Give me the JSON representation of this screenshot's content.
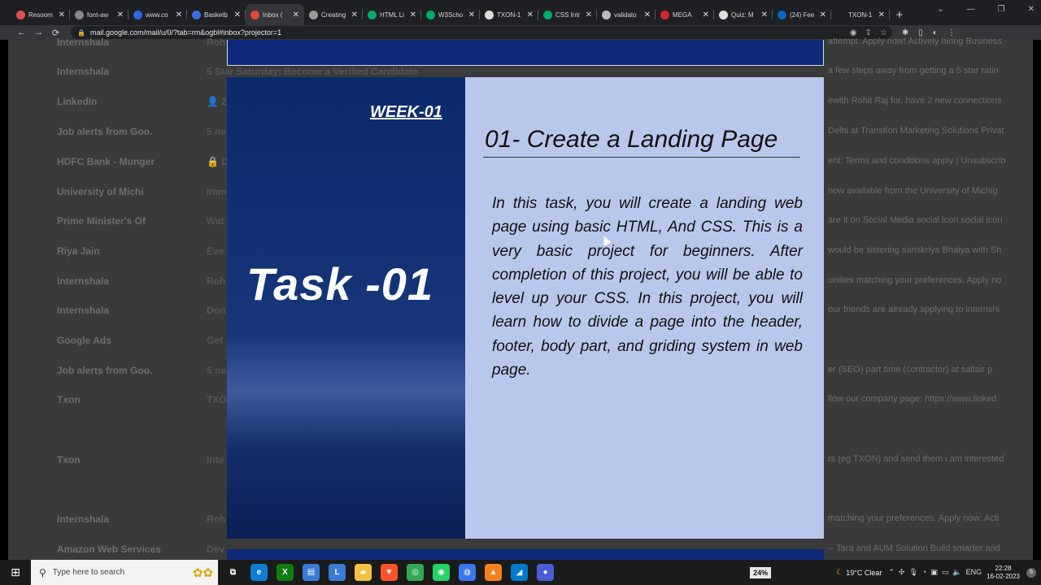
{
  "browser": {
    "tabs": [
      {
        "label": "Resoom",
        "icon": "red-circle-icon",
        "color": "#e05050"
      },
      {
        "label": "font-aw",
        "icon": "code-icon",
        "color": "#888888"
      },
      {
        "label": "www.co",
        "icon": "c-icon",
        "color": "#2a6ae0"
      },
      {
        "label": "Basketb",
        "icon": "flag-icon",
        "color": "#3b6fe0"
      },
      {
        "label": "Inbox (",
        "icon": "gmail-icon",
        "color": "#e04a3a",
        "active": true
      },
      {
        "label": "Creating",
        "icon": "doc-icon",
        "color": "#999999"
      },
      {
        "label": "HTML Li",
        "icon": "w-icon",
        "color": "#04aa6d"
      },
      {
        "label": "W3Scho",
        "icon": "w-icon",
        "color": "#04aa6d"
      },
      {
        "label": "TXON-1",
        "icon": "github-icon",
        "color": "#dddddd"
      },
      {
        "label": "CSS Intr",
        "icon": "w-icon",
        "color": "#04aa6d"
      },
      {
        "label": "validato",
        "icon": "validator-icon",
        "color": "#bbbbbb"
      },
      {
        "label": "MEGA",
        "icon": "mega-icon",
        "color": "#d9272e"
      },
      {
        "label": "Quiz: M",
        "icon": "g-icon",
        "color": "#dddddd"
      },
      {
        "label": "(24) Fee",
        "icon": "linkedin-icon",
        "color": "#0a66c2"
      },
      {
        "label": "TXON-1",
        "icon": "blank-icon",
        "color": "#1f2023"
      }
    ],
    "new_tab": "+",
    "url": "mail.google.com/mail/u/0/?tab=rm&ogbl#inbox?projector=1",
    "nav": {
      "back": "←",
      "forward": "→",
      "reload": "⟳"
    }
  },
  "inbox": {
    "rows": [
      {
        "sender": "Internshala",
        "subject": "Roh",
        "snippet": "attempt. Apply now! Actively hiring Business"
      },
      {
        "sender": "Internshala",
        "subject": "5 Star Saturday: Become a Verified Candidate",
        "snippet": "a few steps away from getting a 5 star ratin"
      },
      {
        "sender": "LinkedIn",
        "subject": "👤 2",
        "snippet": "ewith Rohit Raj for, have 2 new connections"
      },
      {
        "sender": "Job alerts from Goo.",
        "subject": "5 ne",
        "snippet": "Delhi at Transtion Marketing Solutions Privat"
      },
      {
        "sender": "HDFC Bank - Munger",
        "subject": "🔒 D",
        "snippet": "ent: Terms and conditions apply | Unsubscrib"
      },
      {
        "sender": "University of Michi",
        "subject": "Imm",
        "snippet": "now available from the University of Michig"
      },
      {
        "sender": "Prime Minister's Of",
        "subject": "Wat",
        "snippet": "are it on Social Media social icon social icon"
      },
      {
        "sender": "Riya Jain",
        "subject": "Eve",
        "snippet": "would be sistering sanskriya Bhaiya with Sh"
      },
      {
        "sender": "Internshala",
        "subject": "Roh",
        "snippet": "unities matching your preferences. Apply no"
      },
      {
        "sender": "Internshala",
        "subject": "Don",
        "snippet": "our friends are already applying to internshi"
      },
      {
        "sender": "Google Ads",
        "subject": "Get",
        "snippet": ""
      },
      {
        "sender": "Job alerts from Goo.",
        "subject": "5 ne",
        "snippet": "er (SEO) part time (contractor) at saltair p"
      },
      {
        "sender": "Txon",
        "subject": "TXO",
        "snippet": "llow our company page: https://www.linked"
      },
      {
        "sender": "Txon",
        "subject": "Inte",
        "snippet": "rs (eg TXON) and send them i am interested"
      },
      {
        "sender": "Internshala",
        "subject": "Roh",
        "snippet": "matching your preferences. Apply now: Acti"
      },
      {
        "sender": "Amazon Web Services",
        "subject": "Dev",
        "snippet": "-- Tara and AUM Solution Build smarter and"
      }
    ]
  },
  "slide": {
    "week": "WEEK-01",
    "task": "Task -01",
    "title": "01- Create a Landing Page",
    "body": "In this task, you will create a landing web page using basic HTML, And CSS. This is a very basic project for beginners. After completion of this project, you will be able to level up your CSS. In this project, you will learn how to divide a page into the header, footer, body part, and griding system in web page."
  },
  "taskbar": {
    "search_placeholder": "Type here to search",
    "battery": "24%",
    "weather": "19°C  Clear",
    "language": "ENG",
    "time": "22:28",
    "date": "16-02-2023",
    "notifications": "5",
    "apps": [
      {
        "name": "task-view-icon",
        "glyph": "⧉",
        "color": "#1b1b1b"
      },
      {
        "name": "edge-icon",
        "glyph": "e",
        "color": "#0f7dd4"
      },
      {
        "name": "xbox-icon",
        "glyph": "X",
        "color": "#107c10"
      },
      {
        "name": "store-icon",
        "glyph": "▤",
        "color": "#3a7bd5"
      },
      {
        "name": "l-app-icon",
        "glyph": "L",
        "color": "#3a7bd5"
      },
      {
        "name": "file-explorer-icon",
        "glyph": "▰",
        "color": "#f5c342"
      },
      {
        "name": "brave-icon",
        "glyph": "▼",
        "color": "#fb542b"
      },
      {
        "name": "chrome-icon",
        "glyph": "◎",
        "color": "#34a853"
      },
      {
        "name": "whatsapp-icon",
        "glyph": "◉",
        "color": "#25d366"
      },
      {
        "name": "signal-icon",
        "glyph": "◍",
        "color": "#3a76f0"
      },
      {
        "name": "vlc-icon",
        "glyph": "▲",
        "color": "#f58220"
      },
      {
        "name": "vscode-icon",
        "glyph": "◢",
        "color": "#007acc"
      },
      {
        "name": "app-icon",
        "glyph": "●",
        "color": "#4a5cd6"
      }
    ]
  }
}
